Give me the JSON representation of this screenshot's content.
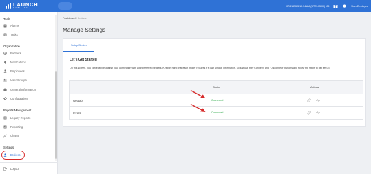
{
  "brand": {
    "name": "LAUNCH",
    "tagline": "MOBILITY"
  },
  "topbar": {
    "datetime": "07/31/2025 10:34 AM (UTC -05:00) -05",
    "user_label": "User Employee"
  },
  "sidebar": {
    "sections": [
      {
        "title": "Tools",
        "items": [
          {
            "label": "Alarms",
            "icon": "alarm-icon"
          },
          {
            "label": "Tasks",
            "icon": "tasks-icon"
          }
        ]
      },
      {
        "title": "Organization",
        "items": [
          {
            "label": "Partners",
            "icon": "globe-icon"
          },
          {
            "label": "Notifications",
            "icon": "bell-icon"
          },
          {
            "label": "Employees",
            "icon": "person-icon"
          },
          {
            "label": "User Groups",
            "icon": "users-icon"
          },
          {
            "label": "General Information",
            "icon": "briefcase-icon"
          },
          {
            "label": "Configuration",
            "icon": "gear-icon"
          }
        ]
      },
      {
        "title": "Reports Management",
        "items": [
          {
            "label": "Legacy Reports",
            "icon": "report-icon"
          },
          {
            "label": "Reporting",
            "icon": "bar-chart-icon"
          },
          {
            "label": "Charts",
            "icon": "line-chart-icon"
          }
        ]
      },
      {
        "title": "Settings",
        "items": [
          {
            "label": "Brokers",
            "icon": "broker-person-icon",
            "active": true
          }
        ]
      }
    ],
    "logout_label": "Logout"
  },
  "breadcrumb": {
    "root": "Dashboard",
    "separator": " / ",
    "current": "Brokers"
  },
  "page_title": "Manage Settings",
  "tab_label": "Setup Broker",
  "section_heading": "Let's Get Started",
  "intro_text": "On this screen, you can easily establish your connection with your preferred brokers. Keep in mind that each broker requires it's own unique information, so just use the \"Connect\" and \"Disconnect\" buttons and follow the steps to get set up.",
  "table": {
    "headers": {
      "name": "",
      "status": "Status",
      "actions": "Actions"
    },
    "rows": [
      {
        "name": "Geotab",
        "status": "Connected"
      },
      {
        "name": "Invers",
        "status": "Connected"
      }
    ]
  },
  "colors": {
    "topbar": "#2f72d6",
    "accent": "#2f72d6",
    "status_connected": "#2eaa4a",
    "annotation": "#d62a2a"
  }
}
